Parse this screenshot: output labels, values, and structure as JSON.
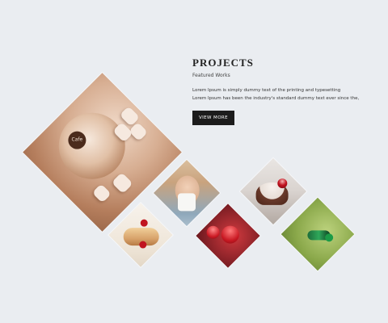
{
  "section": {
    "title": "PROJECTS",
    "subtitle": "Featured Works",
    "description_lines": [
      "Lorem Ipsum is simply dummy text of the printing and typesetting",
      "Lorem Ipsum has been the industry's standard dummy text ever since the,"
    ],
    "button_label": "VIEW MORE"
  },
  "tiles": {
    "coffee": {
      "logo_text": "Cafe"
    }
  }
}
